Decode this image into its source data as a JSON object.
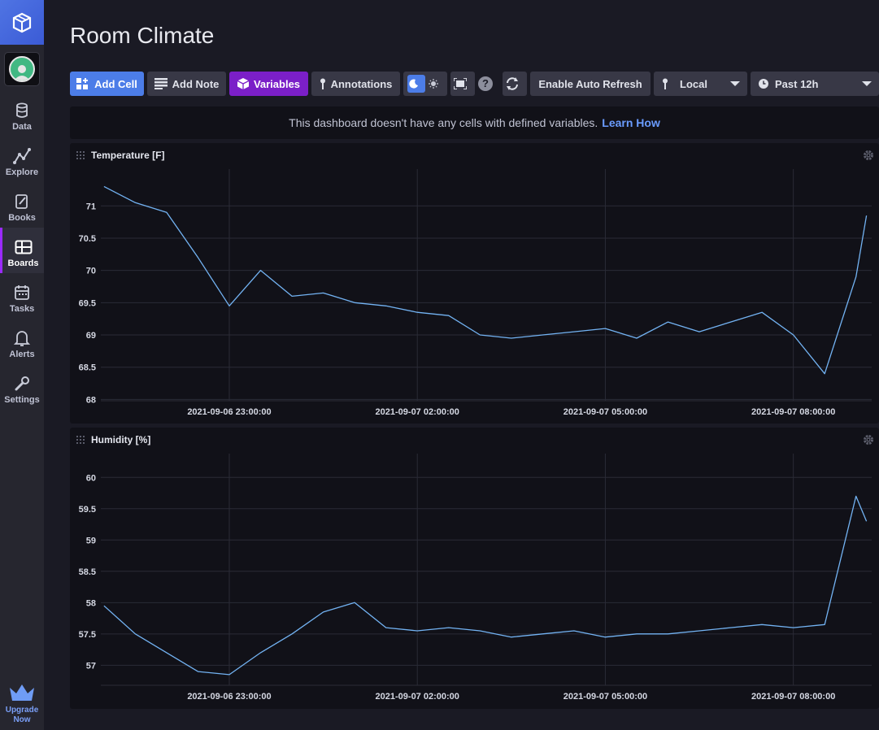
{
  "app": {
    "title": "Room Climate"
  },
  "sidebar": {
    "items": [
      {
        "label": "Data",
        "icon": "database-icon"
      },
      {
        "label": "Explore",
        "icon": "explore-graph-icon"
      },
      {
        "label": "Books",
        "icon": "notebook-icon"
      },
      {
        "label": "Boards",
        "icon": "dashboard-icon",
        "active": true
      },
      {
        "label": "Tasks",
        "icon": "calendar-icon"
      },
      {
        "label": "Alerts",
        "icon": "bell-icon"
      },
      {
        "label": "Settings",
        "icon": "wrench-icon"
      }
    ],
    "upgrade_line1": "Upgrade",
    "upgrade_line2": "Now"
  },
  "toolbar": {
    "add_cell": "Add Cell",
    "add_note": "Add Note",
    "variables": "Variables",
    "annotations": "Annotations",
    "help": "?",
    "auto_refresh": "Enable Auto Refresh",
    "timezone": "Local",
    "time_range": "Past 12h"
  },
  "notice": {
    "text": "This dashboard doesn't have any cells with defined variables.",
    "link": "Learn How"
  },
  "colors": {
    "accent_blue": "#4c7de8",
    "variables_purple": "#7b1fc8",
    "series_line": "#73b3f3",
    "background": "#1a1a24",
    "cell_background": "#111118"
  },
  "chart_data": [
    {
      "type": "line",
      "title": "Temperature [F]",
      "x_tick_labels": [
        "2021-09-06 23:00:00",
        "2021-09-07 02:00:00",
        "2021-09-07 05:00:00",
        "2021-09-07 08:00:00"
      ],
      "x_range": [
        "2021-09-06 20:57:00",
        "2021-09-07 09:15:00"
      ],
      "y_ticks": [
        68,
        68.5,
        69,
        69.5,
        70,
        70.5,
        71
      ],
      "ylim": [
        67.98,
        71.57
      ],
      "grid": true,
      "x": [
        "2021-09-06 21:00",
        "2021-09-06 21:30",
        "2021-09-06 22:00",
        "2021-09-06 22:30",
        "2021-09-06 23:00",
        "2021-09-06 23:30",
        "2021-09-07 00:00",
        "2021-09-07 00:30",
        "2021-09-07 01:00",
        "2021-09-07 01:30",
        "2021-09-07 02:00",
        "2021-09-07 02:30",
        "2021-09-07 03:00",
        "2021-09-07 03:30",
        "2021-09-07 04:00",
        "2021-09-07 04:30",
        "2021-09-07 05:00",
        "2021-09-07 05:30",
        "2021-09-07 06:00",
        "2021-09-07 06:30",
        "2021-09-07 07:00",
        "2021-09-07 07:30",
        "2021-09-07 08:00",
        "2021-09-07 08:30",
        "2021-09-07 09:00",
        "2021-09-07 09:10"
      ],
      "values": [
        71.3,
        71.05,
        70.9,
        70.2,
        69.45,
        70.0,
        69.6,
        69.65,
        69.5,
        69.45,
        69.35,
        69.3,
        69.0,
        68.95,
        69.0,
        69.05,
        69.1,
        68.95,
        69.2,
        69.05,
        69.2,
        69.35,
        69.0,
        68.4,
        69.9,
        70.85
      ]
    },
    {
      "type": "line",
      "title": "Humidity [%]",
      "x_tick_labels": [
        "2021-09-06 23:00:00",
        "2021-09-07 02:00:00",
        "2021-09-07 05:00:00",
        "2021-09-07 08:00:00"
      ],
      "x_range": [
        "2021-09-06 20:57:00",
        "2021-09-07 09:15:00"
      ],
      "y_ticks": [
        57,
        57.5,
        58,
        58.5,
        59,
        59.5,
        60
      ],
      "ylim": [
        56.68,
        60.38
      ],
      "grid": true,
      "x": [
        "2021-09-06 21:00",
        "2021-09-06 21:30",
        "2021-09-06 22:00",
        "2021-09-06 22:30",
        "2021-09-06 23:00",
        "2021-09-06 23:30",
        "2021-09-07 00:00",
        "2021-09-07 00:30",
        "2021-09-07 01:00",
        "2021-09-07 01:30",
        "2021-09-07 02:00",
        "2021-09-07 02:30",
        "2021-09-07 03:00",
        "2021-09-07 03:30",
        "2021-09-07 04:00",
        "2021-09-07 04:30",
        "2021-09-07 05:00",
        "2021-09-07 05:30",
        "2021-09-07 06:00",
        "2021-09-07 06:30",
        "2021-09-07 07:00",
        "2021-09-07 07:30",
        "2021-09-07 08:00",
        "2021-09-07 08:30",
        "2021-09-07 09:00",
        "2021-09-07 09:10"
      ],
      "values": [
        57.95,
        57.5,
        57.2,
        56.9,
        56.85,
        57.2,
        57.5,
        57.85,
        58.0,
        57.6,
        57.55,
        57.6,
        57.55,
        57.45,
        57.5,
        57.55,
        57.45,
        57.5,
        57.5,
        57.55,
        57.6,
        57.65,
        57.6,
        57.65,
        59.7,
        59.3
      ]
    }
  ]
}
